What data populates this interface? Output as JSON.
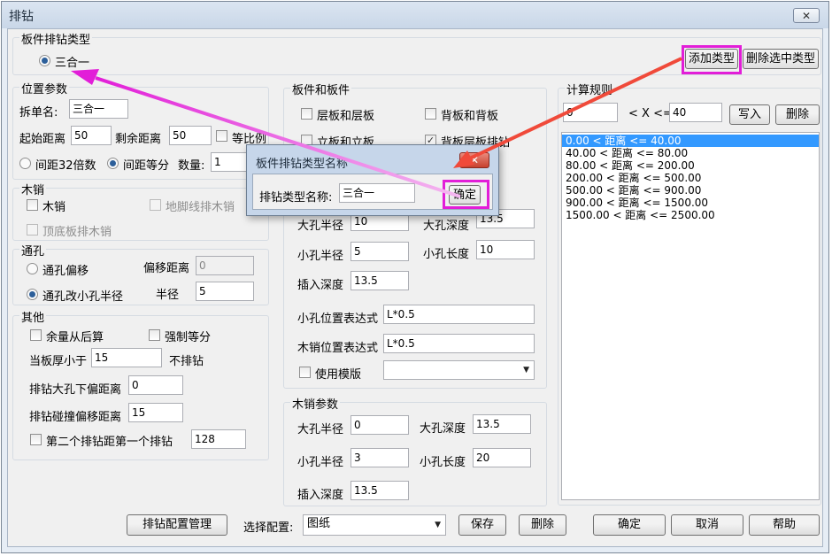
{
  "window": {
    "title": "排钻",
    "close": "✕"
  },
  "panel_type": {
    "legend": "板件排钻类型",
    "option": "三合一"
  },
  "buttons_top": {
    "add_type": "添加类型",
    "delete_type": "删除选中类型"
  },
  "position": {
    "legend": "位置参数",
    "split_label": "拆单名:",
    "split_value": "三合一",
    "start_label": "起始距离",
    "start_value": "50",
    "remain_label": "剩余距离",
    "remain_value": "50",
    "ratio_label": "等比例",
    "gap32_label": "间距32倍数",
    "gap_equal_label": "间距等分",
    "count_label": "数量:",
    "count_value": "1"
  },
  "dowel": {
    "legend": "木销",
    "dowel_label": "木销",
    "floor_label": "地脚线排木销",
    "top_bottom_label": "顶底板排木销"
  },
  "through": {
    "legend": "通孔",
    "offset_label": "通孔偏移",
    "offset_dist_label": "偏移距离",
    "offset_dist_value": "0",
    "change_label": "通孔改小孔半径",
    "radius_label": "半径",
    "radius_value": "5"
  },
  "other": {
    "legend": "其他",
    "surplus_label": "余量从后算",
    "force_label": "强制等分",
    "thin_label": "当板厚小于",
    "thin_value": "15",
    "no_drill_label": "不排钻",
    "big_hole_offset_label": "排钻大孔下偏距离",
    "big_hole_offset_value": "0",
    "collide_label": "排钻碰撞偏移距离",
    "collide_value": "15",
    "second_label": "第二个排钻距第一个排钻",
    "second_value": "128"
  },
  "board": {
    "legend": "板件和板件",
    "layer_layer": "层板和层板",
    "back_back": "背板和背板",
    "vert_vert": "立板和立板",
    "back_layer": "背板层板排钻",
    "big_radius_label": "大孔半径",
    "big_radius_value": "10",
    "big_depth_label": "大孔深度",
    "big_depth_value": "13.5",
    "small_radius_label": "小孔半径",
    "small_radius_value": "5",
    "small_len_label": "小孔长度",
    "small_len_value": "10",
    "insert_depth_label": "插入深度",
    "insert_depth_value": "13.5",
    "small_pos_label": "小孔位置表达式",
    "small_pos_value": "L*0.5",
    "dowel_pos_label": "木销位置表达式",
    "dowel_pos_value": "L*0.5",
    "use_template_label": "使用模版",
    "template_value": ""
  },
  "dowel_params": {
    "legend": "木销参数",
    "big_radius_label": "大孔半径",
    "big_radius_value": "0",
    "big_depth_label": "大孔深度",
    "big_depth_value": "13.5",
    "small_radius_label": "小孔半径",
    "small_radius_value": "3",
    "small_len_label": "小孔长度",
    "small_len_value": "20",
    "insert_depth_label": "插入深度",
    "insert_depth_value": "13.5"
  },
  "rules": {
    "legend": "计算规则",
    "from_value": "0",
    "cond_label": "< X <=",
    "to_value": "40",
    "write_btn": "写入",
    "delete_btn": "删除",
    "items": [
      "0.00 < 距离 <= 40.00",
      "40.00 < 距离 <= 80.00",
      "80.00 < 距离 <= 200.00",
      "200.00 < 距离 <= 500.00",
      "500.00 < 距离 <= 900.00",
      "900.00 < 距离 <= 1500.00",
      "1500.00 < 距离 <= 2500.00"
    ]
  },
  "bottom": {
    "manage_btn": "排钻配置管理",
    "select_label": "选择配置:",
    "select_value": "图纸",
    "save_btn": "保存",
    "delete_btn": "删除",
    "ok_btn": "确定",
    "cancel_btn": "取消",
    "help_btn": "帮助"
  },
  "dialog": {
    "title": "板件排钻类型名称",
    "name_label": "排钻类型名称:",
    "name_value": "三合一",
    "ok_btn": "确定",
    "close": "✕"
  },
  "colors": {
    "annotation": "#e21ed8",
    "selection": "#3399ff"
  }
}
